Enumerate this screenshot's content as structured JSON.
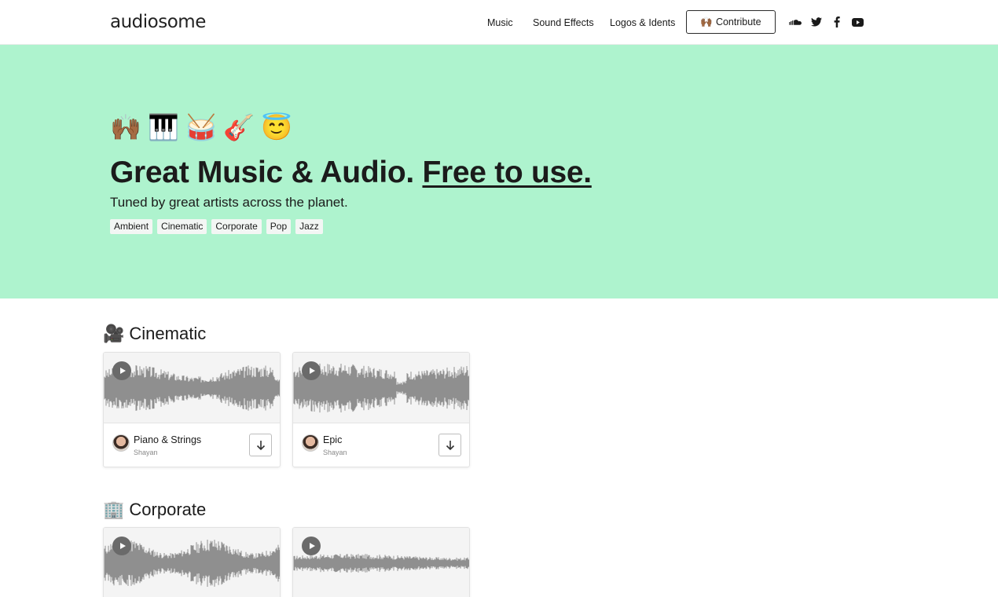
{
  "header": {
    "logo": "audiosome",
    "nav": [
      "Music",
      "Sound Effects",
      "Logos & Idents"
    ],
    "contribute_emoji": "🙌🏾",
    "contribute_label": "Contribute",
    "social_icons": [
      "soundcloud-icon",
      "twitter-icon",
      "facebook-icon",
      "youtube-icon"
    ]
  },
  "hero": {
    "emojis": [
      "🙌🏾",
      "🎹",
      "🥁",
      "🎸",
      "😇"
    ],
    "headline_plain": "Great Music & Audio.",
    "headline_link": "Free to use.",
    "subline": "Tuned by great artists across the planet.",
    "tags": [
      "Ambient",
      "Cinematic",
      "Corporate",
      "Pop",
      "Jazz"
    ],
    "background": "#aef3ce"
  },
  "sections": [
    {
      "emoji": "🎥",
      "title": "Cinematic",
      "tracks": [
        {
          "title": "Piano & Strings",
          "artist": "Shayan"
        },
        {
          "title": "Epic",
          "artist": "Shayan"
        }
      ]
    },
    {
      "emoji": "🏢",
      "title": "Corporate",
      "tracks": [
        {
          "title": "",
          "artist": ""
        },
        {
          "title": "",
          "artist": ""
        }
      ]
    }
  ],
  "colors": {
    "waveform": "#8f8f8f",
    "play_button": "#6a6a6a"
  }
}
